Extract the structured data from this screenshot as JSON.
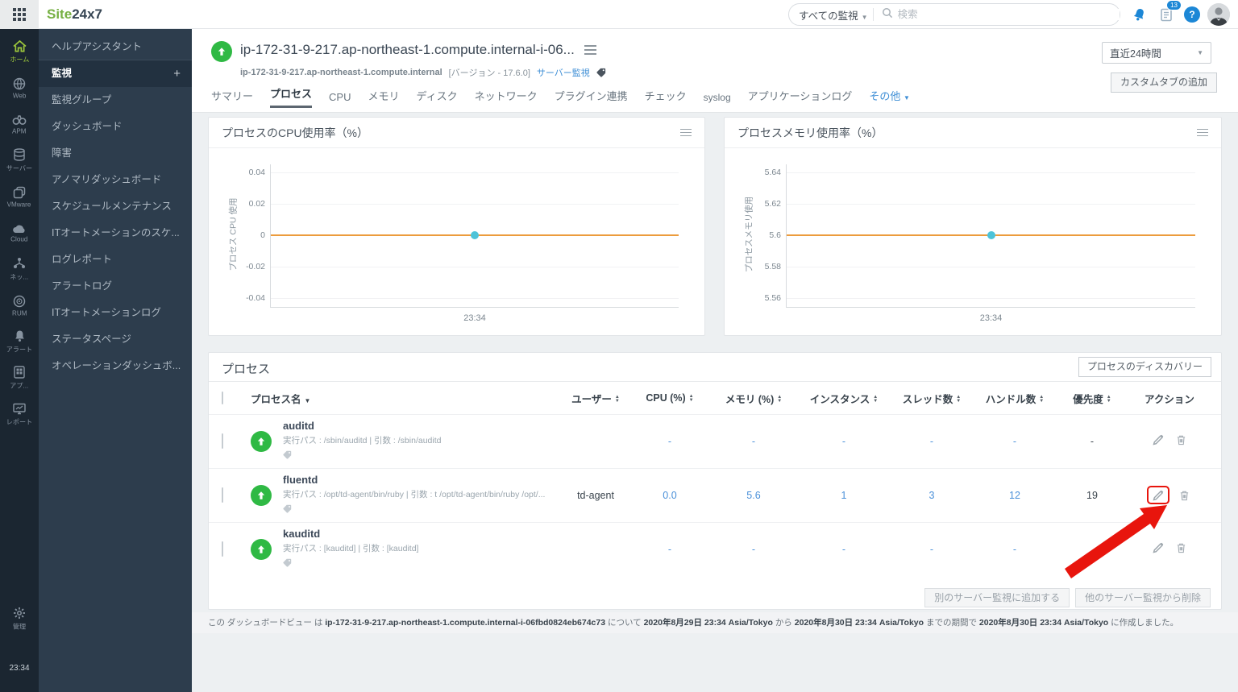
{
  "topbar": {
    "logo_site": "Site",
    "logo_24x7": "24x7",
    "search": {
      "scope": "すべての監視",
      "placeholder": "検索"
    },
    "notification_badge": "13"
  },
  "icon_sidebar": {
    "items": [
      {
        "label": "ホーム",
        "icon": "home-icon",
        "active": true
      },
      {
        "label": "Web",
        "icon": "globe-icon",
        "active": false
      },
      {
        "label": "APM",
        "icon": "binoculars-icon",
        "active": false
      },
      {
        "label": "サーバー",
        "icon": "server-icon",
        "active": false
      },
      {
        "label": "VMware",
        "icon": "vmware-icon",
        "active": false
      },
      {
        "label": "Cloud",
        "icon": "cloud-icon",
        "active": false
      },
      {
        "label": "ネッ...",
        "icon": "network-icon",
        "active": false
      },
      {
        "label": "RUM",
        "icon": "rum-icon",
        "active": false
      },
      {
        "label": "アラート",
        "icon": "bell-icon",
        "active": false
      },
      {
        "label": "アプ...",
        "icon": "app-icon",
        "active": false
      },
      {
        "label": "レポート",
        "icon": "report-icon",
        "active": false
      }
    ],
    "admin_label": "管理",
    "time": "23:34"
  },
  "menu_sidebar": {
    "add_label": "+",
    "items": [
      {
        "label": "ヘルプアシスタント",
        "active": false
      },
      {
        "label": "監視",
        "active": true
      },
      {
        "label": "監視グループ",
        "active": false
      },
      {
        "label": "ダッシュボード",
        "active": false
      },
      {
        "label": "障害",
        "active": false
      },
      {
        "label": "アノマリダッシュボード",
        "active": false
      },
      {
        "label": "スケジュールメンテナンス",
        "active": false
      },
      {
        "label": "ITオートメーションのスケ...",
        "active": false
      },
      {
        "label": "ログレポート",
        "active": false
      },
      {
        "label": "アラートログ",
        "active": false
      },
      {
        "label": "ITオートメーションログ",
        "active": false
      },
      {
        "label": "ステータスページ",
        "active": false
      },
      {
        "label": "オペレーションダッシュボ...",
        "active": false
      }
    ]
  },
  "monitor_header": {
    "title": "ip-172-31-9-217.ap-northeast-1.compute.internal-i-06...",
    "host": "ip-172-31-9-217.ap-northeast-1.compute.internal",
    "version": "[バージョン - 17.6.0]",
    "type_link": "サーバー監視"
  },
  "tabs": [
    {
      "label": "サマリー"
    },
    {
      "label": "プロセス",
      "active": true
    },
    {
      "label": "CPU"
    },
    {
      "label": "メモリ"
    },
    {
      "label": "ディスク"
    },
    {
      "label": "ネットワーク"
    },
    {
      "label": "プラグイン連携"
    },
    {
      "label": "チェック"
    },
    {
      "label": "syslog"
    },
    {
      "label": "アプリケーションログ"
    },
    {
      "label": "その他"
    }
  ],
  "controls": {
    "time_range": "直近24時間",
    "custom_tab_button": "カスタムタブの追加"
  },
  "charts": [
    {
      "title": "プロセスのCPU使用率（%）",
      "ylabel": "プロセス CPU 使用",
      "y_ticks": [
        "0.04",
        "0.02",
        "0",
        "-0.02",
        "-0.04"
      ],
      "x_tick": "23:34",
      "chart_data": {
        "type": "line",
        "title": "プロセスのCPU使用率（%）",
        "xlabel": "",
        "ylabel": "プロセス CPU 使用",
        "x": [
          "23:34"
        ],
        "series": [
          {
            "name": "プロセス CPU 使用",
            "values": [
              0
            ]
          }
        ],
        "ylim": [
          -0.05,
          0.05
        ],
        "grid": true,
        "line_color": "#ec9c3d",
        "marker_color": "#4dc3d8",
        "legend_position": "none"
      }
    },
    {
      "title": "プロセスメモリ使用率（%）",
      "ylabel": "プロセスメモリ使用",
      "y_ticks": [
        "5.64",
        "5.62",
        "5.6",
        "5.58",
        "5.56"
      ],
      "x_tick": "23:34",
      "chart_data": {
        "type": "line",
        "title": "プロセスメモリ使用率（%）",
        "xlabel": "",
        "ylabel": "プロセスメモリ使用",
        "x": [
          "23:34"
        ],
        "series": [
          {
            "name": "プロセスメモリ使用",
            "values": [
              5.6
            ]
          }
        ],
        "ylim": [
          5.55,
          5.65
        ],
        "grid": true,
        "line_color": "#ec9c3d",
        "marker_color": "#4dc3d8",
        "legend_position": "none"
      }
    }
  ],
  "process_panel": {
    "title": "プロセス",
    "discovery_button": "プロセスのディスカバリー",
    "columns": [
      {
        "label": "プロセス名"
      },
      {
        "label": "ユーザー"
      },
      {
        "label": "CPU (%)"
      },
      {
        "label": "メモリ (%)"
      },
      {
        "label": "インスタンス"
      },
      {
        "label": "スレッド数"
      },
      {
        "label": "ハンドル数"
      },
      {
        "label": "優先度"
      },
      {
        "label": "アクション"
      }
    ],
    "rows": [
      {
        "name": "auditd",
        "path": "実行パス : /sbin/auditd | 引数 : /sbin/auditd",
        "user": "",
        "cpu": "-",
        "mem": "-",
        "instances": "-",
        "threads": "-",
        "handles": "-",
        "priority": "-"
      },
      {
        "name": "fluentd",
        "path": "実行パス : /opt/td-agent/bin/ruby | 引数 : t /opt/td-agent/bin/ruby /opt/...",
        "user": "td-agent",
        "cpu": "0.0",
        "mem": "5.6",
        "instances": "1",
        "threads": "3",
        "handles": "12",
        "priority": "19"
      },
      {
        "name": "kauditd",
        "path": "実行パス : [kauditd] | 引数 : [kauditd]",
        "user": "",
        "cpu": "-",
        "mem": "-",
        "instances": "-",
        "threads": "-",
        "handles": "-",
        "priority": ""
      }
    ],
    "footer_buttons": [
      {
        "label": "別のサーバー監視に追加する"
      },
      {
        "label": "他のサーバー監視から削除"
      }
    ]
  },
  "footer": {
    "segments": [
      {
        "text": "この ダッシュボードビュー は "
      },
      {
        "text": "ip-172-31-9-217.ap-northeast-1.compute.internal-i-06fbd0824eb674c73",
        "bold": true
      },
      {
        "text": " について "
      },
      {
        "text": "2020年8月29日 23:34 Asia/Tokyo",
        "bold": true
      },
      {
        "text": " から "
      },
      {
        "text": "2020年8月30日 23:34 Asia/Tokyo",
        "bold": true
      },
      {
        "text": " までの期間で "
      },
      {
        "text": "2020年8月30日 23:34 Asia/Tokyo",
        "bold": true
      },
      {
        "text": " に作成しました。"
      }
    ]
  },
  "annotation": {
    "highlight_color": "#e8150d"
  }
}
